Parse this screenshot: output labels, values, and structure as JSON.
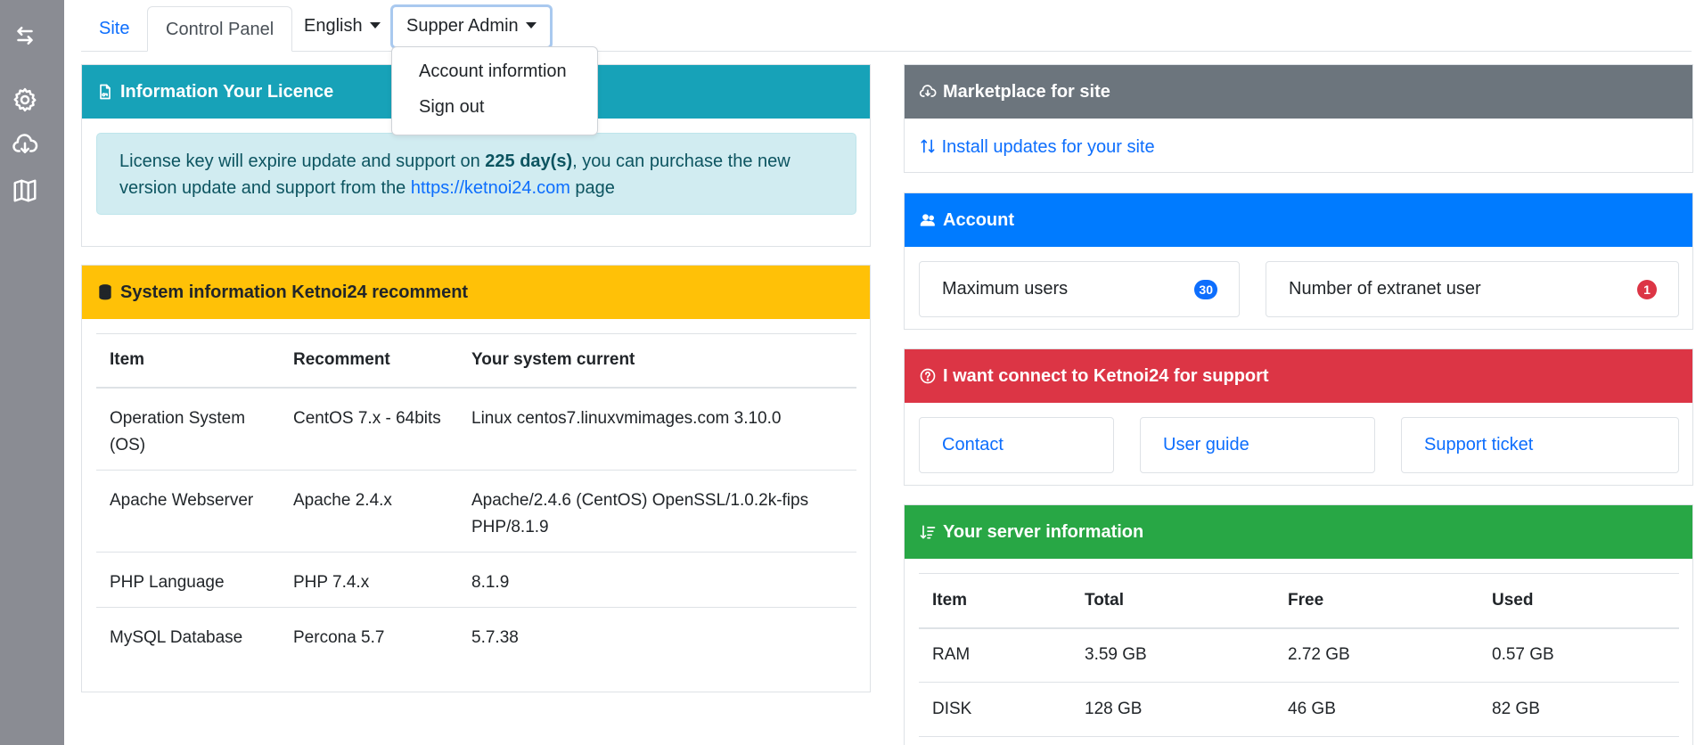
{
  "sidebar": {
    "icons": [
      "collapse-arrows-icon",
      "gear-icon",
      "cloud-download-icon",
      "map-icon"
    ]
  },
  "topnav": {
    "site_tab": "Site",
    "control_panel_tab": "Control Panel",
    "language_dropdown": "English",
    "user_dropdown": "Supper Admin",
    "user_menu": {
      "account_info": "Account informtion",
      "sign_out": "Sign out"
    }
  },
  "licence": {
    "title": "Information Your Licence",
    "text_before": "License key will expire update and support on ",
    "days": "225 day(s)",
    "text_middle": ", you can purchase the new version update and support from the ",
    "link": "https://ketnoi24.com",
    "text_after": " page"
  },
  "system": {
    "title": "System information Ketnoi24 recomment",
    "headers": [
      "Item",
      "Recomment",
      "Your system current"
    ],
    "rows": [
      [
        "Operation System (OS)",
        "CentOS 7.x - 64bits",
        "Linux centos7.linuxvmimages.com 3.10.0"
      ],
      [
        "Apache Webserver",
        "Apache 2.4.x",
        "Apache/2.4.6 (CentOS) OpenSSL/1.0.2k-fips PHP/8.1.9"
      ],
      [
        "PHP Language",
        "PHP 7.4.x",
        "8.1.9"
      ],
      [
        "MySQL Database",
        "Percona 5.7",
        "5.7.38"
      ]
    ]
  },
  "marketplace": {
    "title": "Marketplace for site",
    "link": "Install updates for your site"
  },
  "account": {
    "title": "Account",
    "max_users_label": "Maximum users",
    "max_users_value": "30",
    "extranet_label": "Number of extranet user",
    "extranet_value": "1"
  },
  "support": {
    "title": "I want connect to Ketnoi24 for support",
    "buttons": [
      "Contact",
      "User guide",
      "Support ticket"
    ]
  },
  "server": {
    "title": "Your server information",
    "headers": [
      "Item",
      "Total",
      "Free",
      "Used"
    ],
    "rows": [
      [
        "RAM",
        "3.59 GB",
        "2.72 GB",
        "0.57 GB"
      ],
      [
        "DISK",
        "128 GB",
        "46 GB",
        "82 GB"
      ]
    ]
  },
  "colors": {
    "rail": "#8a8c93",
    "info": "#17a2b8",
    "warning": "#ffc107",
    "secondary": "#6c757d",
    "primary": "#007bff",
    "danger": "#dc3545",
    "success": "#28a745",
    "link": "#0d6efd"
  }
}
